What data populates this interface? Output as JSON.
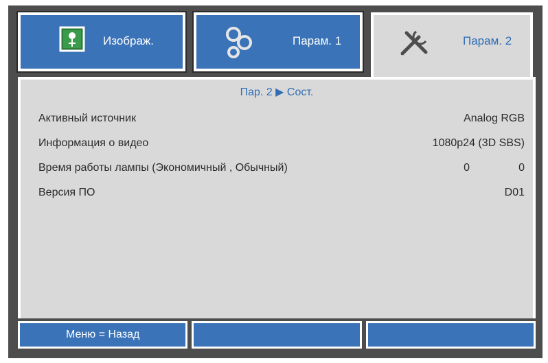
{
  "tabs": [
    {
      "label": "Изображ.",
      "icon": "image-icon",
      "active": false
    },
    {
      "label": "Парам. 1",
      "icon": "gears-icon",
      "active": false
    },
    {
      "label": "Парам. 2",
      "icon": "tools-icon",
      "active": true
    }
  ],
  "breadcrumb": "Пар. 2 ▶ Сост.",
  "status": {
    "active_source": {
      "label": "Активный источник",
      "value": "Analog RGB"
    },
    "video_info": {
      "label": "Информация о видео",
      "value": "1080p24  (3D SBS)"
    },
    "lamp_hours": {
      "label": "Время работы лампы (Экономичный , Обычный)",
      "eco": "0",
      "normal": "0"
    },
    "firmware": {
      "label": "Версия ПО",
      "value": "D01"
    }
  },
  "footer": {
    "back_label": "Меню = Назад",
    "slot2": "",
    "slot3": ""
  },
  "colors": {
    "tab_blue": "#3a73b7",
    "accent_text": "#2f6eb5",
    "panel_gray": "#d9d9d9",
    "frame_dark": "#4d4d4d"
  }
}
